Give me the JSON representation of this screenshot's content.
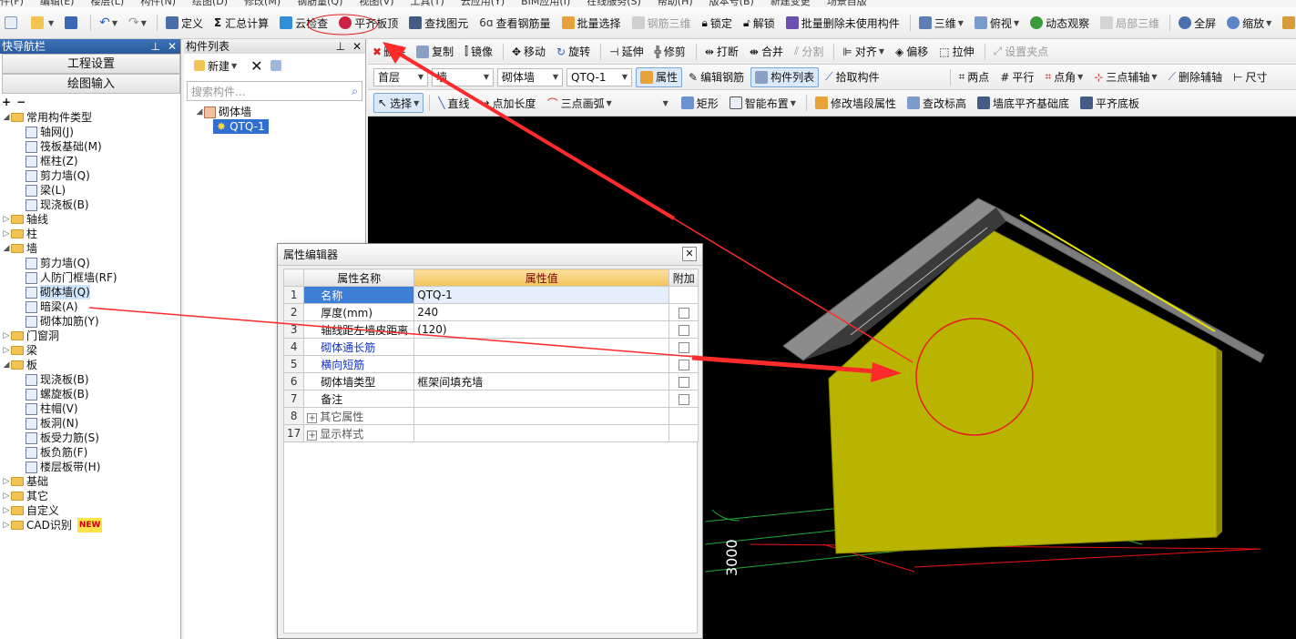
{
  "menu": [
    "件(F)",
    "编辑(E)",
    "楼层(L)",
    "构件(N)",
    "绘图(D)",
    "修改(M)",
    "钢筋量(Q)",
    "视图(V)",
    "工具(T)",
    "云应用(Y)",
    "BIM应用(I)",
    "在线服务(S)",
    "帮助(H)",
    "版本号(B)",
    "新建变更",
    "场景自版"
  ],
  "toolbar1": {
    "define": "定义",
    "sum_calc": "汇总计算",
    "cloud_check": "云检查",
    "align_slab_top": "平齐板顶",
    "find_element": "查找图元",
    "view_rebar": "查看钢筋量",
    "batch_select": "批量选择",
    "rebar_3d": "钢筋三维",
    "lock": "锁定",
    "unlock": "解锁",
    "batch_delete_unused": "批量删除未使用构件",
    "three_d": "三维",
    "top_view": "俯视",
    "dynamic_observe": "动态观察",
    "local_3d": "局部三维",
    "full_screen": "全屏",
    "zoom": "缩放",
    "pan": "平移"
  },
  "toolbar2": {
    "delete": "删除",
    "copy": "复制",
    "mirror": "镜像",
    "move": "移动",
    "rotate": "旋转",
    "extend": "延伸",
    "trim": "修剪",
    "break": "打断",
    "merge": "合并",
    "split": "分割",
    "align": "对齐",
    "offset": "偏移",
    "stretch": "拉伸",
    "set_grip": "设置夹点"
  },
  "toolbar3": {
    "floor": "首层",
    "category": "墙",
    "type": "砌体墙",
    "component": "QTQ-1",
    "properties": "属性",
    "edit_rebar": "编辑钢筋",
    "component_list": "构件列表",
    "pick_component": "拾取构件",
    "two_points": "两点",
    "parallel": "平行",
    "point_angle": "点角",
    "three_point_aux": "三点辅轴",
    "delete_aux": "删除辅轴",
    "dimension": "尺寸"
  },
  "toolbar4": {
    "select": "选择",
    "line": "直线",
    "point_length": "点加长度",
    "three_point_arc": "三点画弧",
    "rectangle": "矩形",
    "smart_layout": "智能布置",
    "modify_wall_segment": "修改墙段属性",
    "check_elevation": "查改标高",
    "wall_bottom_align": "墙底平齐基础底",
    "align_slab_bottom": "平齐底板"
  },
  "left_nav": {
    "title": "快导航栏",
    "btn_project": "工程设置",
    "btn_draw": "绘图输入",
    "tree": [
      {
        "label": "常用构件类型",
        "level": 0,
        "folder": true,
        "open": true
      },
      {
        "label": "轴网(J)",
        "level": 1
      },
      {
        "label": "筏板基础(M)",
        "level": 1
      },
      {
        "label": "框柱(Z)",
        "level": 1
      },
      {
        "label": "剪力墙(Q)",
        "level": 1
      },
      {
        "label": "梁(L)",
        "level": 1
      },
      {
        "label": "现浇板(B)",
        "level": 1
      },
      {
        "label": "轴线",
        "level": 0,
        "folder": true
      },
      {
        "label": "柱",
        "level": 0,
        "folder": true
      },
      {
        "label": "墙",
        "level": 0,
        "folder": true,
        "open": true
      },
      {
        "label": "剪力墙(Q)",
        "level": 1
      },
      {
        "label": "人防门框墙(RF)",
        "level": 1
      },
      {
        "label": "砌体墙(Q)",
        "level": 1,
        "selected": true
      },
      {
        "label": "暗梁(A)",
        "level": 1
      },
      {
        "label": "砌体加筋(Y)",
        "level": 1
      },
      {
        "label": "门窗洞",
        "level": 0,
        "folder": true
      },
      {
        "label": "梁",
        "level": 0,
        "folder": true
      },
      {
        "label": "板",
        "level": 0,
        "folder": true,
        "open": true
      },
      {
        "label": "现浇板(B)",
        "level": 1
      },
      {
        "label": "螺旋板(B)",
        "level": 1
      },
      {
        "label": "柱帽(V)",
        "level": 1
      },
      {
        "label": "板洞(N)",
        "level": 1
      },
      {
        "label": "板受力筋(S)",
        "level": 1
      },
      {
        "label": "板负筋(F)",
        "level": 1
      },
      {
        "label": "楼层板带(H)",
        "level": 1
      },
      {
        "label": "基础",
        "level": 0,
        "folder": true
      },
      {
        "label": "其它",
        "level": 0,
        "folder": true
      },
      {
        "label": "自定义",
        "level": 0,
        "folder": true
      },
      {
        "label": "CAD识别",
        "level": 0,
        "folder": true,
        "badge": "NEW"
      }
    ]
  },
  "component_list": {
    "title": "构件列表",
    "new": "新建",
    "search_placeholder": "搜索构件...",
    "root": "砌体墙",
    "item": "QTQ-1"
  },
  "property_editor": {
    "title": "属性编辑器",
    "col_name": "属性名称",
    "col_value": "属性值",
    "col_extra": "附加",
    "rows": [
      {
        "n": "1",
        "name": "名称",
        "value": "QTQ-1",
        "check": false,
        "blue": false,
        "selected": true
      },
      {
        "n": "2",
        "name": "厚度(mm)",
        "value": "240",
        "check": true,
        "blue": false
      },
      {
        "n": "3",
        "name": "轴线距左墙皮距离",
        "value": "(120)",
        "check": true,
        "blue": false
      },
      {
        "n": "4",
        "name": "砌体通长筋",
        "value": "",
        "check": true,
        "blue": true
      },
      {
        "n": "5",
        "name": "横向短筋",
        "value": "",
        "check": true,
        "blue": true
      },
      {
        "n": "6",
        "name": "砌体墙类型",
        "value": "框架间填充墙",
        "check": true,
        "blue": false
      },
      {
        "n": "7",
        "name": "备注",
        "value": "",
        "check": true,
        "blue": false
      },
      {
        "n": "8",
        "name": "其它属性",
        "value": "",
        "group": true
      },
      {
        "n": "17",
        "name": "显示样式",
        "value": "",
        "group": true
      }
    ]
  },
  "canvas": {
    "dimension_label": "3000",
    "wall_color": "#b8b400",
    "roof_color": "#8c8c8c",
    "annotation_color": "#ff2b2b"
  }
}
